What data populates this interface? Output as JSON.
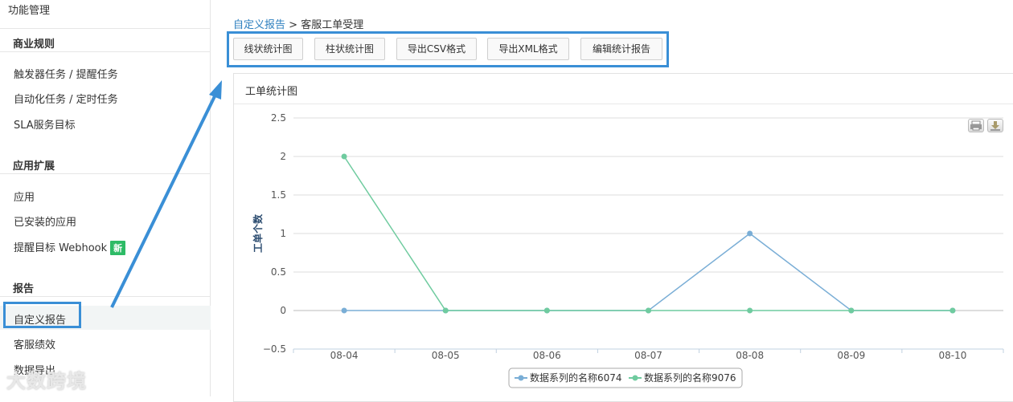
{
  "sidebar": {
    "top_label": "功能管理",
    "sections": [
      {
        "heading": "商业规则",
        "items": [
          "触发器任务 / 提醒任务",
          "自动化任务 / 定时任务",
          "SLA服务目标"
        ]
      },
      {
        "heading": "应用扩展",
        "items": [
          "应用",
          "已安装的应用",
          "提醒目标 Webhook"
        ],
        "badge": "新"
      },
      {
        "heading": "报告",
        "items": [
          "自定义报告",
          "客服绩效",
          "数据导出"
        ]
      }
    ]
  },
  "breadcrumb": {
    "parent": "自定义报告",
    "separator": ">",
    "current": "客服工单受理"
  },
  "toolbar": {
    "buttons": [
      "线状统计图",
      "柱状统计图",
      "导出CSV格式",
      "导出XML格式",
      "编辑统计报告"
    ]
  },
  "panel": {
    "title": "工单统计图"
  },
  "watermark": "大数跨境",
  "colors": {
    "highlight": "#3a8fd6",
    "series1": "#7aaed6",
    "series2": "#6fcb9f",
    "link": "#2d7fbf",
    "badge": "#2dbb66"
  },
  "icons": [
    "print-icon",
    "download-icon",
    "arrow-annotation"
  ],
  "chart_data": {
    "type": "line",
    "title": "",
    "xlabel": "",
    "ylabel": "工单个数",
    "categories": [
      "08-04",
      "08-05",
      "08-06",
      "08-07",
      "08-08",
      "08-09",
      "08-10"
    ],
    "yticks": [
      "2.5",
      "2",
      "1.5",
      "1",
      "0.5",
      "0",
      "−0.5"
    ],
    "ylim": [
      -0.5,
      2.5
    ],
    "grid": true,
    "legend_position": "bottom-center",
    "series": [
      {
        "name": "数据系列的名称6074",
        "values": [
          0,
          0,
          0,
          0,
          1,
          0,
          0
        ]
      },
      {
        "name": "数据系列的名称9076",
        "values": [
          2,
          0,
          0,
          0,
          0,
          0,
          0
        ]
      }
    ]
  }
}
